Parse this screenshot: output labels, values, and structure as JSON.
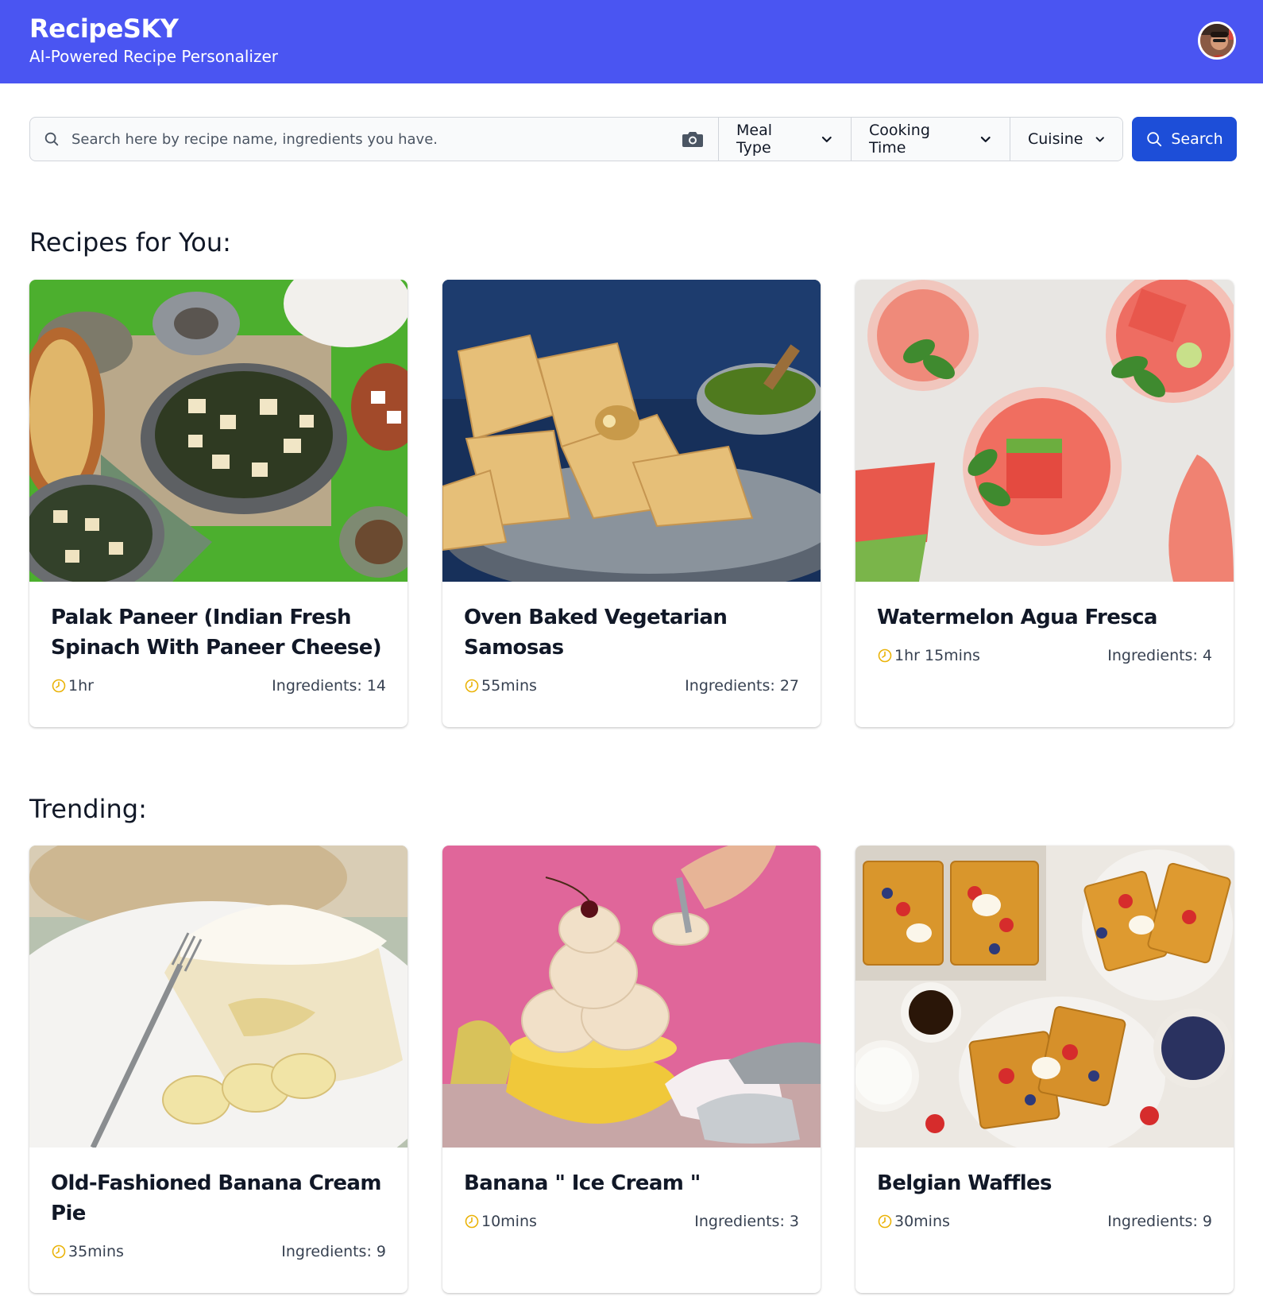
{
  "header": {
    "title": "RecipeSKY",
    "subtitle": "AI-Powered Recipe Personalizer",
    "background_color": "#4a55f2"
  },
  "search": {
    "placeholder": "Search here by recipe name, ingredients you have.",
    "value": "",
    "button_label": "Search",
    "button_color": "#1d4ed8",
    "filters": [
      {
        "label": "Meal Type"
      },
      {
        "label": "Cooking Time"
      },
      {
        "label": "Cuisine"
      }
    ]
  },
  "sections": [
    {
      "title": "Recipes for You:",
      "recipes": [
        {
          "title": "Palak Paneer (Indian Fresh Spinach With Paneer Cheese)",
          "time": "1hr",
          "ingredients": "Ingredients: 14",
          "image": "palak-paneer"
        },
        {
          "title": "Oven Baked Vegetarian Samosas",
          "time": "55mins",
          "ingredients": "Ingredients: 27",
          "image": "samosas"
        },
        {
          "title": "Watermelon Agua Fresca",
          "time": "1hr 15mins",
          "ingredients": "Ingredients: 4",
          "image": "agua-fresca"
        }
      ]
    },
    {
      "title": "Trending:",
      "recipes": [
        {
          "title": "Old-Fashioned Banana Cream Pie",
          "time": "35mins",
          "ingredients": "Ingredients: 9",
          "image": "banana-cream-pie"
        },
        {
          "title": "Banana \" Ice Cream \"",
          "time": "10mins",
          "ingredients": "Ingredients: 3",
          "image": "banana-ice-cream"
        },
        {
          "title": "Belgian Waffles",
          "time": "30mins",
          "ingredients": "Ingredients: 9",
          "image": "belgian-waffles"
        }
      ]
    }
  ],
  "icons": {
    "clock_color": "#eab308"
  }
}
